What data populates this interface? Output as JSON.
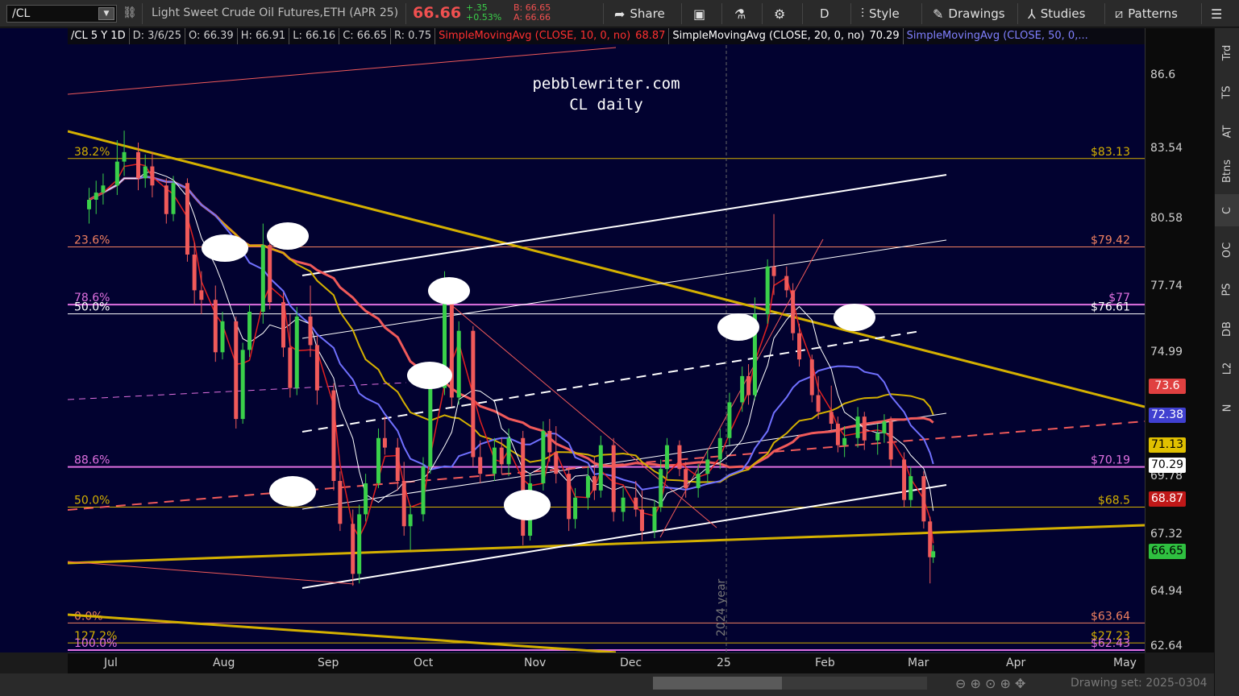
{
  "toolbar": {
    "symbol": "/CL",
    "description": "Light Sweet Crude Oil Futures,ETH (APR 25)",
    "last": "66.66",
    "change_abs": "+.35",
    "change_pct": "+0.53%",
    "bid": "B: 66.65",
    "ask": "A: 66.66",
    "share": "Share",
    "timeframe": "D",
    "style": "Style",
    "drawings": "Drawings",
    "studies": "Studies",
    "patterns": "Patterns"
  },
  "header": {
    "symbol_period": "/CL 5 Y 1D",
    "date": "D: 3/6/25",
    "open": "O: 66.39",
    "high": "H: 66.91",
    "low": "L: 66.16",
    "close": "C: 66.65",
    "range": "R: 0.75",
    "sma10": "SimpleMovingAvg (CLOSE, 10, 0, no)",
    "sma10_val": "68.87",
    "sma20": "SimpleMovingAvg (CLOSE, 20, 0, no)",
    "sma20_val": "70.29",
    "sma50": "SimpleMovingAvg (CLOSE, 50, 0,..."
  },
  "right_sidebar": [
    "Trd",
    "TS",
    "AT",
    "Btns",
    "C",
    "OC",
    "PS",
    "DB",
    "L2",
    "N"
  ],
  "bottom": {
    "drawing_set": "Drawing set: 2025-0304"
  },
  "colors": {
    "background": "#020230",
    "up": "#3ad04a",
    "down": "#f05a5a",
    "sma10": "#e02020",
    "sma20": "#ffffff",
    "sma50": "#7070ff",
    "sma100": "#d4b000",
    "sma200": "#f05a5a",
    "fib": "#d4b000",
    "magenta": "#e070e0"
  },
  "chart_data": {
    "type": "candlestick",
    "title": "pebblewriter.com",
    "subtitle": "CL daily",
    "x_ticks": [
      "Jul",
      "Aug",
      "Sep",
      "Oct",
      "Nov",
      "Dec",
      "25",
      "Feb",
      "Mar",
      "Apr",
      "May"
    ],
    "x_tick_dates": [
      "2024-07-01",
      "2024-08-01",
      "2024-09-01",
      "2024-10-01",
      "2024-11-01",
      "2024-12-01",
      "2025-01-01",
      "2025-02-01",
      "2025-03-01",
      "2025-04-01",
      "2025-05-01"
    ],
    "y_ticks": [
      86.6,
      83.54,
      80.58,
      77.74,
      74.99,
      69.78,
      67.32,
      64.94,
      62.64
    ],
    "ylim": [
      62.4,
      88.6
    ],
    "period_label": "2024 year",
    "fib_levels": [
      {
        "pct": "38.2%",
        "price": "$83.13",
        "value": 83.13,
        "color": "#d4b000"
      },
      {
        "pct": "23.6%",
        "price": "$79.42",
        "value": 79.42,
        "color": "#f08060"
      },
      {
        "pct": "78.6%",
        "price": "$77",
        "value": 77.0,
        "color": "#e070e0"
      },
      {
        "pct": "50.0%",
        "price": "$76.61",
        "value": 76.61,
        "color": "#ffffff"
      },
      {
        "pct": "88.6%",
        "price": "$70.19",
        "value": 70.19,
        "color": "#e070e0"
      },
      {
        "pct": "50.0%",
        "price": "$68.5",
        "value": 68.5,
        "color": "#d4b000"
      },
      {
        "pct": "0.0%",
        "price": "$63.64",
        "value": 63.64,
        "color": "#f08060"
      },
      {
        "pct": "127.2%",
        "price": "$27.23",
        "value": 62.8,
        "color": "#d4b000"
      },
      {
        "pct": "100.0%",
        "price": "$62.43",
        "value": 62.5,
        "color": "#e070e0"
      }
    ],
    "price_tags": [
      {
        "label": "73.6",
        "value": 73.6,
        "bg": "#e04040",
        "fg": "#ffffff"
      },
      {
        "label": "72.38",
        "value": 72.38,
        "bg": "#4040d0",
        "fg": "#ffffff"
      },
      {
        "label": "71.13",
        "value": 71.13,
        "bg": "#e0c000",
        "fg": "#000000"
      },
      {
        "label": "70.29",
        "value": 70.29,
        "bg": "#ffffff",
        "fg": "#000000"
      },
      {
        "label": "68.87",
        "value": 68.87,
        "bg": "#c01818",
        "fg": "#ffffff"
      },
      {
        "label": "66.65",
        "value": 66.65,
        "bg": "#2fc040",
        "fg": "#000000"
      }
    ],
    "candles": [
      {
        "d": "2024-06-24",
        "o": 81.0,
        "h": 81.9,
        "l": 80.4,
        "c": 81.4
      },
      {
        "d": "2024-06-26",
        "o": 81.4,
        "h": 82.2,
        "l": 80.8,
        "c": 81.7
      },
      {
        "d": "2024-06-28",
        "o": 81.7,
        "h": 82.5,
        "l": 81.2,
        "c": 82.0
      },
      {
        "d": "2024-07-02",
        "o": 82.0,
        "h": 83.9,
        "l": 81.6,
        "c": 83.0
      },
      {
        "d": "2024-07-04",
        "o": 83.0,
        "h": 84.3,
        "l": 82.4,
        "c": 83.4
      },
      {
        "d": "2024-07-08",
        "o": 83.4,
        "h": 83.8,
        "l": 81.8,
        "c": 82.3
      },
      {
        "d": "2024-07-10",
        "o": 82.3,
        "h": 83.3,
        "l": 81.9,
        "c": 82.8
      },
      {
        "d": "2024-07-12",
        "o": 82.8,
        "h": 83.4,
        "l": 81.5,
        "c": 82.0
      },
      {
        "d": "2024-07-16",
        "o": 82.0,
        "h": 82.3,
        "l": 80.4,
        "c": 80.8
      },
      {
        "d": "2024-07-18",
        "o": 80.8,
        "h": 82.4,
        "l": 80.5,
        "c": 82.1
      },
      {
        "d": "2024-07-22",
        "o": 82.1,
        "h": 82.3,
        "l": 78.8,
        "c": 79.1
      },
      {
        "d": "2024-07-24",
        "o": 79.1,
        "h": 79.6,
        "l": 77.0,
        "c": 77.6
      },
      {
        "d": "2024-07-26",
        "o": 77.6,
        "h": 78.4,
        "l": 76.6,
        "c": 77.2
      },
      {
        "d": "2024-07-30",
        "o": 77.2,
        "h": 77.8,
        "l": 74.6,
        "c": 75.0
      },
      {
        "d": "2024-08-01",
        "o": 75.0,
        "h": 76.7,
        "l": 74.7,
        "c": 76.3
      },
      {
        "d": "2024-08-05",
        "o": 76.3,
        "h": 76.5,
        "l": 71.8,
        "c": 72.2
      },
      {
        "d": "2024-08-07",
        "o": 72.2,
        "h": 75.4,
        "l": 72.0,
        "c": 75.1
      },
      {
        "d": "2024-08-09",
        "o": 75.1,
        "h": 77.0,
        "l": 74.8,
        "c": 76.7
      },
      {
        "d": "2024-08-13",
        "o": 76.7,
        "h": 80.4,
        "l": 76.2,
        "c": 79.5
      },
      {
        "d": "2024-08-15",
        "o": 79.5,
        "h": 79.9,
        "l": 76.8,
        "c": 77.1
      },
      {
        "d": "2024-08-19",
        "o": 77.1,
        "h": 77.5,
        "l": 74.8,
        "c": 75.2
      },
      {
        "d": "2024-08-21",
        "o": 75.2,
        "h": 76.6,
        "l": 73.1,
        "c": 73.5
      },
      {
        "d": "2024-08-23",
        "o": 73.5,
        "h": 76.9,
        "l": 73.2,
        "c": 76.5
      },
      {
        "d": "2024-08-27",
        "o": 76.5,
        "h": 77.8,
        "l": 74.8,
        "c": 75.3
      },
      {
        "d": "2024-08-29",
        "o": 75.3,
        "h": 75.7,
        "l": 72.8,
        "c": 73.4
      },
      {
        "d": "2024-09-03",
        "o": 73.4,
        "h": 73.7,
        "l": 69.2,
        "c": 69.6
      },
      {
        "d": "2024-09-05",
        "o": 69.6,
        "h": 70.0,
        "l": 67.5,
        "c": 67.8
      },
      {
        "d": "2024-09-09",
        "o": 67.8,
        "h": 68.4,
        "l": 65.2,
        "c": 65.7
      },
      {
        "d": "2024-09-11",
        "o": 65.7,
        "h": 68.6,
        "l": 65.3,
        "c": 68.2
      },
      {
        "d": "2024-09-13",
        "o": 68.2,
        "h": 69.9,
        "l": 67.9,
        "c": 69.5
      },
      {
        "d": "2024-09-17",
        "o": 69.5,
        "h": 71.8,
        "l": 69.3,
        "c": 71.4
      },
      {
        "d": "2024-09-19",
        "o": 71.4,
        "h": 72.3,
        "l": 70.7,
        "c": 71.0
      },
      {
        "d": "2024-09-23",
        "o": 71.0,
        "h": 71.4,
        "l": 69.2,
        "c": 69.6
      },
      {
        "d": "2024-09-25",
        "o": 69.6,
        "h": 70.4,
        "l": 67.3,
        "c": 67.7
      },
      {
        "d": "2024-09-27",
        "o": 67.7,
        "h": 68.6,
        "l": 66.7,
        "c": 68.2
      },
      {
        "d": "2024-10-01",
        "o": 68.2,
        "h": 70.6,
        "l": 67.9,
        "c": 70.2
      },
      {
        "d": "2024-10-03",
        "o": 70.2,
        "h": 73.9,
        "l": 69.9,
        "c": 73.5
      },
      {
        "d": "2024-10-07",
        "o": 73.5,
        "h": 78.4,
        "l": 73.2,
        "c": 77.2
      },
      {
        "d": "2024-10-09",
        "o": 77.2,
        "h": 77.6,
        "l": 72.7,
        "c": 73.1
      },
      {
        "d": "2024-10-11",
        "o": 73.1,
        "h": 76.3,
        "l": 72.8,
        "c": 75.9
      },
      {
        "d": "2024-10-15",
        "o": 75.9,
        "h": 76.1,
        "l": 70.2,
        "c": 70.6
      },
      {
        "d": "2024-10-17",
        "o": 70.6,
        "h": 71.3,
        "l": 69.5,
        "c": 69.9
      },
      {
        "d": "2024-10-21",
        "o": 69.9,
        "h": 71.4,
        "l": 69.6,
        "c": 71.0
      },
      {
        "d": "2024-10-23",
        "o": 71.0,
        "h": 71.4,
        "l": 69.9,
        "c": 70.3
      },
      {
        "d": "2024-10-25",
        "o": 70.3,
        "h": 71.8,
        "l": 69.8,
        "c": 71.4
      },
      {
        "d": "2024-10-29",
        "o": 71.4,
        "h": 71.7,
        "l": 66.9,
        "c": 67.3
      },
      {
        "d": "2024-10-31",
        "o": 67.3,
        "h": 69.9,
        "l": 67.1,
        "c": 69.5
      },
      {
        "d": "2024-11-04",
        "o": 69.5,
        "h": 72.1,
        "l": 69.2,
        "c": 71.7
      },
      {
        "d": "2024-11-06",
        "o": 71.7,
        "h": 72.2,
        "l": 70.4,
        "c": 70.8
      },
      {
        "d": "2024-11-08",
        "o": 70.8,
        "h": 71.9,
        "l": 69.5,
        "c": 69.9
      },
      {
        "d": "2024-11-12",
        "o": 69.9,
        "h": 70.2,
        "l": 67.5,
        "c": 68.0
      },
      {
        "d": "2024-11-14",
        "o": 68.0,
        "h": 69.3,
        "l": 67.6,
        "c": 68.9
      },
      {
        "d": "2024-11-18",
        "o": 68.9,
        "h": 70.2,
        "l": 68.4,
        "c": 69.8
      },
      {
        "d": "2024-11-20",
        "o": 69.8,
        "h": 70.6,
        "l": 68.8,
        "c": 69.2
      },
      {
        "d": "2024-11-22",
        "o": 69.2,
        "h": 71.5,
        "l": 68.9,
        "c": 71.1
      },
      {
        "d": "2024-11-26",
        "o": 71.1,
        "h": 71.4,
        "l": 67.9,
        "c": 68.3
      },
      {
        "d": "2024-11-29",
        "o": 68.3,
        "h": 69.3,
        "l": 67.9,
        "c": 68.9
      },
      {
        "d": "2024-12-03",
        "o": 68.9,
        "h": 69.6,
        "l": 68.1,
        "c": 68.4
      },
      {
        "d": "2024-12-05",
        "o": 68.4,
        "h": 69.2,
        "l": 67.1,
        "c": 67.5
      },
      {
        "d": "2024-12-09",
        "o": 67.5,
        "h": 68.8,
        "l": 67.2,
        "c": 68.5
      },
      {
        "d": "2024-12-11",
        "o": 68.5,
        "h": 70.5,
        "l": 68.3,
        "c": 70.1
      },
      {
        "d": "2024-12-13",
        "o": 70.1,
        "h": 71.4,
        "l": 69.7,
        "c": 71.1
      },
      {
        "d": "2024-12-17",
        "o": 71.1,
        "h": 71.3,
        "l": 69.8,
        "c": 70.1
      },
      {
        "d": "2024-12-19",
        "o": 70.1,
        "h": 70.4,
        "l": 68.9,
        "c": 69.3
      },
      {
        "d": "2024-12-23",
        "o": 69.3,
        "h": 70.3,
        "l": 68.9,
        "c": 69.9
      },
      {
        "d": "2024-12-26",
        "o": 69.9,
        "h": 70.9,
        "l": 69.5,
        "c": 70.5
      },
      {
        "d": "2024-12-30",
        "o": 70.5,
        "h": 71.8,
        "l": 70.1,
        "c": 71.4
      },
      {
        "d": "2025-01-02",
        "o": 71.4,
        "h": 73.3,
        "l": 71.1,
        "c": 72.9
      },
      {
        "d": "2025-01-06",
        "o": 72.9,
        "h": 74.4,
        "l": 72.5,
        "c": 74.0
      },
      {
        "d": "2025-01-08",
        "o": 74.0,
        "h": 74.5,
        "l": 72.8,
        "c": 73.2
      },
      {
        "d": "2025-01-10",
        "o": 73.2,
        "h": 77.3,
        "l": 73.0,
        "c": 76.6
      },
      {
        "d": "2025-01-14",
        "o": 76.6,
        "h": 78.9,
        "l": 76.2,
        "c": 78.6
      },
      {
        "d": "2025-01-16",
        "o": 78.6,
        "h": 80.8,
        "l": 77.4,
        "c": 78.2
      },
      {
        "d": "2025-01-20",
        "o": 78.2,
        "h": 78.6,
        "l": 77.3,
        "c": 77.6
      },
      {
        "d": "2025-01-22",
        "o": 77.6,
        "h": 77.9,
        "l": 75.5,
        "c": 75.8
      },
      {
        "d": "2025-01-24",
        "o": 75.8,
        "h": 76.2,
        "l": 74.4,
        "c": 74.7
      },
      {
        "d": "2025-01-28",
        "o": 74.7,
        "h": 74.9,
        "l": 72.9,
        "c": 73.2
      },
      {
        "d": "2025-01-30",
        "o": 73.2,
        "h": 74.0,
        "l": 72.2,
        "c": 72.5
      },
      {
        "d": "2025-02-03",
        "o": 72.5,
        "h": 73.6,
        "l": 71.7,
        "c": 72.0
      },
      {
        "d": "2025-02-05",
        "o": 72.0,
        "h": 72.3,
        "l": 70.8,
        "c": 71.1
      },
      {
        "d": "2025-02-07",
        "o": 71.1,
        "h": 71.9,
        "l": 70.6,
        "c": 71.4
      },
      {
        "d": "2025-02-11",
        "o": 71.4,
        "h": 72.7,
        "l": 71.0,
        "c": 72.3
      },
      {
        "d": "2025-02-13",
        "o": 72.3,
        "h": 72.5,
        "l": 70.9,
        "c": 71.3
      },
      {
        "d": "2025-02-17",
        "o": 71.3,
        "h": 72.0,
        "l": 70.7,
        "c": 71.6
      },
      {
        "d": "2025-02-19",
        "o": 71.6,
        "h": 72.4,
        "l": 71.2,
        "c": 72.1
      },
      {
        "d": "2025-02-21",
        "o": 72.1,
        "h": 72.3,
        "l": 70.2,
        "c": 70.5
      },
      {
        "d": "2025-02-25",
        "o": 70.5,
        "h": 70.8,
        "l": 68.5,
        "c": 68.8
      },
      {
        "d": "2025-02-27",
        "o": 68.8,
        "h": 70.2,
        "l": 68.5,
        "c": 69.8
      },
      {
        "d": "2025-03-03",
        "o": 69.8,
        "h": 70.0,
        "l": 67.6,
        "c": 67.9
      },
      {
        "d": "2025-03-05",
        "o": 67.9,
        "h": 68.1,
        "l": 65.3,
        "c": 66.4
      },
      {
        "d": "2025-03-06",
        "o": 66.39,
        "h": 66.91,
        "l": 66.16,
        "c": 66.65
      }
    ]
  }
}
